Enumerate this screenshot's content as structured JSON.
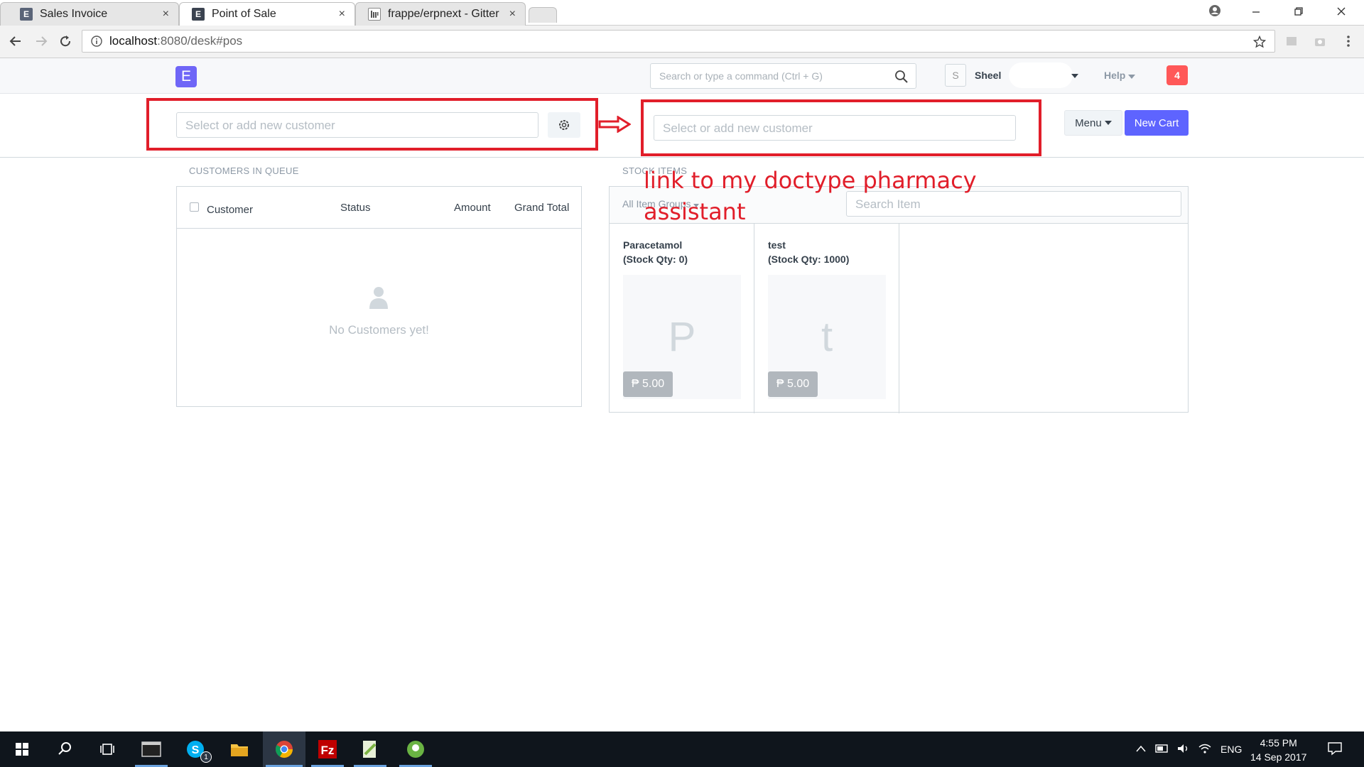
{
  "browser": {
    "tabs": [
      {
        "label": "Sales Invoice",
        "favicon": "E",
        "active": false
      },
      {
        "label": "Point of Sale",
        "favicon": "E",
        "active": true
      },
      {
        "label": "frappe/erpnext - Gitter",
        "favicon": "gitter",
        "active": false
      }
    ],
    "tab_close": "×",
    "url_host": "localhost",
    "url_path": ":8080/desk#pos"
  },
  "navbar": {
    "logo_letter": "E",
    "search_placeholder": "Search or type a command (Ctrl + G)",
    "avatar_letter": "S",
    "username": "Sheel",
    "help_label": "Help",
    "notification_count": "4"
  },
  "pos": {
    "customer_placeholder": "Select or add new customer",
    "customer_placeholder_2": "Select or add new customer",
    "menu_label": "Menu",
    "new_cart_label": "New Cart",
    "annotation_line1": "link to my doctype pharmacy",
    "annotation_line2": "assistant",
    "queue": {
      "section_label": "CUSTOMERS IN QUEUE",
      "columns": [
        "Customer",
        "Status",
        "Amount",
        "Grand Total"
      ],
      "empty_text": "No Customers yet!"
    },
    "stock": {
      "section_label": "STOCK ITEMS",
      "groups_label": "All Item Groups",
      "search_placeholder": "Search Item",
      "items": [
        {
          "name": "Paracetamol",
          "qty": "(Stock Qty: 0)",
          "initial": "P",
          "price": "₱ 5.00"
        },
        {
          "name": "test",
          "qty": "(Stock Qty: 1000)",
          "initial": "t",
          "price": "₱ 5.00"
        }
      ]
    }
  },
  "taskbar": {
    "language": "ENG",
    "time": "4:55 PM",
    "date": "14 Sep 2017",
    "skype_badge": "1"
  },
  "colors": {
    "accent": "#5e64ff",
    "annotation_red": "#e11e2a",
    "logo": "#6f66f7",
    "notification": "#ff5858"
  }
}
